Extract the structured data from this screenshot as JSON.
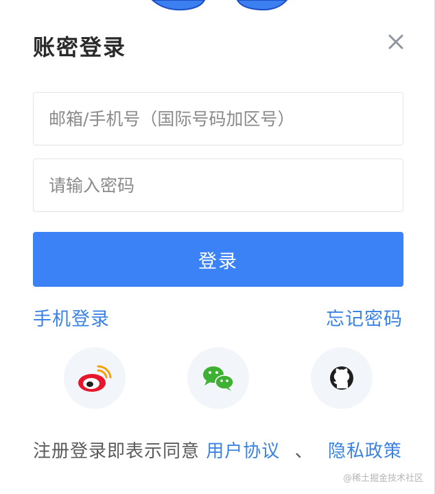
{
  "header": {
    "title": "账密登录",
    "close_icon": "close-icon"
  },
  "form": {
    "account_placeholder": "邮箱/手机号（国际号码加区号）",
    "account_value": "",
    "password_placeholder": "请输入密码",
    "password_value": "",
    "login_label": "登录"
  },
  "links": {
    "phone_login": "手机登录",
    "forgot_password": "忘记密码"
  },
  "social": [
    {
      "name": "weibo",
      "icon": "weibo-icon",
      "color": "#e6162d"
    },
    {
      "name": "wechat",
      "icon": "wechat-icon",
      "color": "#3eb135"
    },
    {
      "name": "github",
      "icon": "github-icon",
      "color": "#1f1f1f"
    }
  ],
  "agreement": {
    "prefix": "注册登录即表示同意",
    "user_agreement": "用户协议",
    "separator": "、",
    "privacy_policy": "隐私政策"
  },
  "watermark": "@稀土掘金技术社区",
  "colors": {
    "primary": "#3b82f6",
    "link": "#3a82e4",
    "title": "#2a2a2a"
  }
}
